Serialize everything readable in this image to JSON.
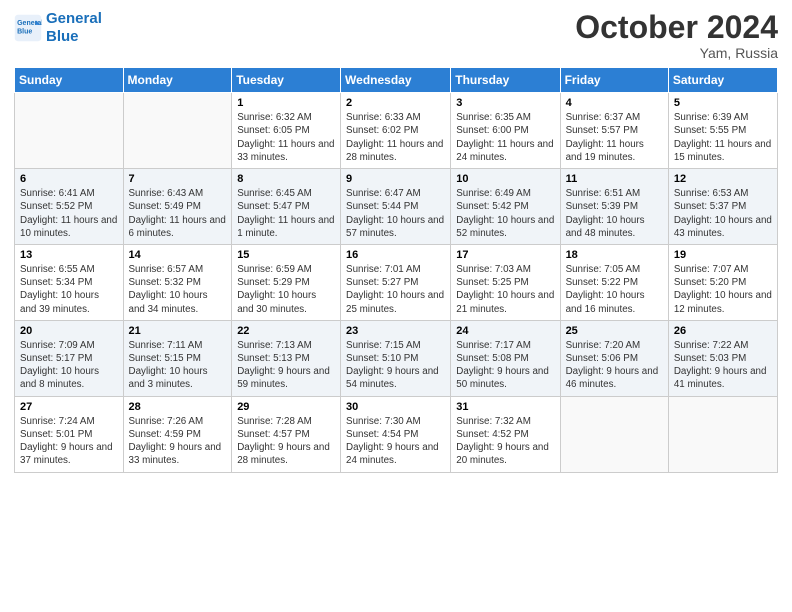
{
  "header": {
    "logo_line1": "General",
    "logo_line2": "Blue",
    "month": "October 2024",
    "location": "Yam, Russia"
  },
  "weekdays": [
    "Sunday",
    "Monday",
    "Tuesday",
    "Wednesday",
    "Thursday",
    "Friday",
    "Saturday"
  ],
  "weeks": [
    [
      {
        "day": "",
        "info": ""
      },
      {
        "day": "",
        "info": ""
      },
      {
        "day": "1",
        "info": "Sunrise: 6:32 AM\nSunset: 6:05 PM\nDaylight: 11 hours and 33 minutes."
      },
      {
        "day": "2",
        "info": "Sunrise: 6:33 AM\nSunset: 6:02 PM\nDaylight: 11 hours and 28 minutes."
      },
      {
        "day": "3",
        "info": "Sunrise: 6:35 AM\nSunset: 6:00 PM\nDaylight: 11 hours and 24 minutes."
      },
      {
        "day": "4",
        "info": "Sunrise: 6:37 AM\nSunset: 5:57 PM\nDaylight: 11 hours and 19 minutes."
      },
      {
        "day": "5",
        "info": "Sunrise: 6:39 AM\nSunset: 5:55 PM\nDaylight: 11 hours and 15 minutes."
      }
    ],
    [
      {
        "day": "6",
        "info": "Sunrise: 6:41 AM\nSunset: 5:52 PM\nDaylight: 11 hours and 10 minutes."
      },
      {
        "day": "7",
        "info": "Sunrise: 6:43 AM\nSunset: 5:49 PM\nDaylight: 11 hours and 6 minutes."
      },
      {
        "day": "8",
        "info": "Sunrise: 6:45 AM\nSunset: 5:47 PM\nDaylight: 11 hours and 1 minute."
      },
      {
        "day": "9",
        "info": "Sunrise: 6:47 AM\nSunset: 5:44 PM\nDaylight: 10 hours and 57 minutes."
      },
      {
        "day": "10",
        "info": "Sunrise: 6:49 AM\nSunset: 5:42 PM\nDaylight: 10 hours and 52 minutes."
      },
      {
        "day": "11",
        "info": "Sunrise: 6:51 AM\nSunset: 5:39 PM\nDaylight: 10 hours and 48 minutes."
      },
      {
        "day": "12",
        "info": "Sunrise: 6:53 AM\nSunset: 5:37 PM\nDaylight: 10 hours and 43 minutes."
      }
    ],
    [
      {
        "day": "13",
        "info": "Sunrise: 6:55 AM\nSunset: 5:34 PM\nDaylight: 10 hours and 39 minutes."
      },
      {
        "day": "14",
        "info": "Sunrise: 6:57 AM\nSunset: 5:32 PM\nDaylight: 10 hours and 34 minutes."
      },
      {
        "day": "15",
        "info": "Sunrise: 6:59 AM\nSunset: 5:29 PM\nDaylight: 10 hours and 30 minutes."
      },
      {
        "day": "16",
        "info": "Sunrise: 7:01 AM\nSunset: 5:27 PM\nDaylight: 10 hours and 25 minutes."
      },
      {
        "day": "17",
        "info": "Sunrise: 7:03 AM\nSunset: 5:25 PM\nDaylight: 10 hours and 21 minutes."
      },
      {
        "day": "18",
        "info": "Sunrise: 7:05 AM\nSunset: 5:22 PM\nDaylight: 10 hours and 16 minutes."
      },
      {
        "day": "19",
        "info": "Sunrise: 7:07 AM\nSunset: 5:20 PM\nDaylight: 10 hours and 12 minutes."
      }
    ],
    [
      {
        "day": "20",
        "info": "Sunrise: 7:09 AM\nSunset: 5:17 PM\nDaylight: 10 hours and 8 minutes."
      },
      {
        "day": "21",
        "info": "Sunrise: 7:11 AM\nSunset: 5:15 PM\nDaylight: 10 hours and 3 minutes."
      },
      {
        "day": "22",
        "info": "Sunrise: 7:13 AM\nSunset: 5:13 PM\nDaylight: 9 hours and 59 minutes."
      },
      {
        "day": "23",
        "info": "Sunrise: 7:15 AM\nSunset: 5:10 PM\nDaylight: 9 hours and 54 minutes."
      },
      {
        "day": "24",
        "info": "Sunrise: 7:17 AM\nSunset: 5:08 PM\nDaylight: 9 hours and 50 minutes."
      },
      {
        "day": "25",
        "info": "Sunrise: 7:20 AM\nSunset: 5:06 PM\nDaylight: 9 hours and 46 minutes."
      },
      {
        "day": "26",
        "info": "Sunrise: 7:22 AM\nSunset: 5:03 PM\nDaylight: 9 hours and 41 minutes."
      }
    ],
    [
      {
        "day": "27",
        "info": "Sunrise: 7:24 AM\nSunset: 5:01 PM\nDaylight: 9 hours and 37 minutes."
      },
      {
        "day": "28",
        "info": "Sunrise: 7:26 AM\nSunset: 4:59 PM\nDaylight: 9 hours and 33 minutes."
      },
      {
        "day": "29",
        "info": "Sunrise: 7:28 AM\nSunset: 4:57 PM\nDaylight: 9 hours and 28 minutes."
      },
      {
        "day": "30",
        "info": "Sunrise: 7:30 AM\nSunset: 4:54 PM\nDaylight: 9 hours and 24 minutes."
      },
      {
        "day": "31",
        "info": "Sunrise: 7:32 AM\nSunset: 4:52 PM\nDaylight: 9 hours and 20 minutes."
      },
      {
        "day": "",
        "info": ""
      },
      {
        "day": "",
        "info": ""
      }
    ]
  ]
}
